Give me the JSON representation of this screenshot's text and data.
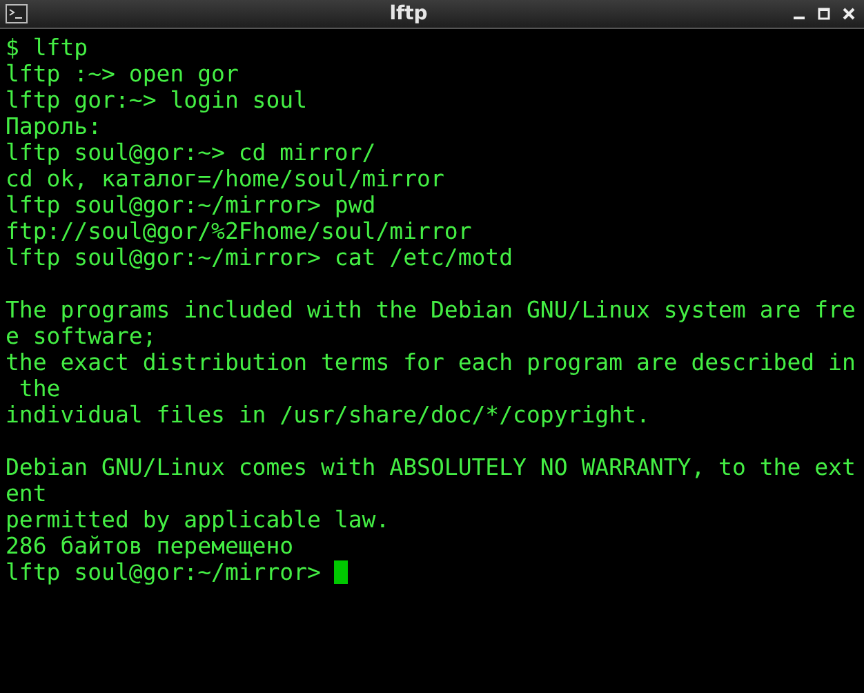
{
  "window": {
    "title": "lftp"
  },
  "terminal": {
    "blocks": [
      [
        "$ lftp",
        "lftp :~> open gor",
        "lftp gor:~> login soul",
        "Пароль:",
        "lftp soul@gor:~> cd mirror/",
        "cd ok, каталог=/home/soul/mirror",
        "lftp soul@gor:~/mirror> pwd",
        "ftp://soul@gor/%2Fhome/soul/mirror",
        "lftp soul@gor:~/mirror> cat /etc/motd"
      ],
      [
        "The programs included with the Debian GNU/Linux system are fre",
        "e software;",
        "the exact distribution terms for each program are described in",
        " the",
        "individual files in /usr/share/doc/*/copyright."
      ],
      [
        "Debian GNU/Linux comes with ABSOLUTELY NO WARRANTY, to the ext",
        "ent",
        "permitted by applicable law.",
        "286 байтов перемещено"
      ]
    ],
    "prompt": "lftp soul@gor:~/mirror> ",
    "cursor_visible": true
  }
}
